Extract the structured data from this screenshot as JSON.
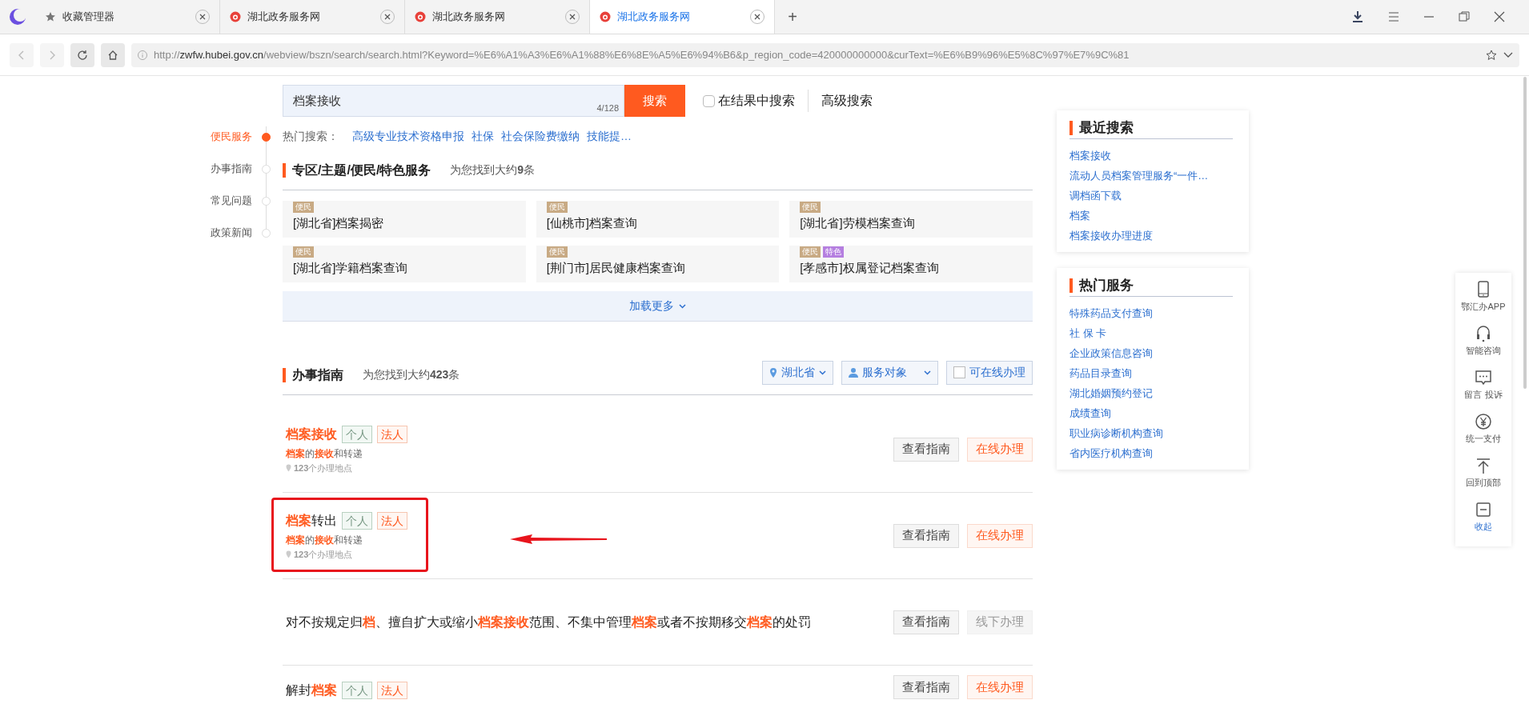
{
  "browser": {
    "tabs": [
      {
        "kind": "bookmarks",
        "label": "收藏管理器",
        "selected": false
      },
      {
        "kind": "site",
        "label": "湖北政务服务网",
        "selected": false
      },
      {
        "kind": "site",
        "label": "湖北政务服务网",
        "selected": false
      },
      {
        "kind": "site",
        "label": "湖北政务服务网",
        "selected": true
      }
    ],
    "new_tab": "+",
    "url_prefix": "http://",
    "url_host": "zwfw.hubei.gov.cn",
    "url_rest": "/webview/bszn/search/search.html?Keyword=%E6%A1%A3%E6%A1%88%E6%8E%A5%E6%94%B6&p_region_code=420000000000&curText=%E6%B9%96%E5%8C%97%E7%9C%81"
  },
  "side_nav": [
    {
      "label": "便民服务",
      "selected": true
    },
    {
      "label": "办事指南",
      "selected": false
    },
    {
      "label": "常见问题",
      "selected": false
    },
    {
      "label": "政策新闻",
      "selected": false
    }
  ],
  "search": {
    "value": "档案接收",
    "counter": "4/128",
    "button": "搜索",
    "within_results": {
      "label": "在结果中搜索",
      "checked": false
    },
    "advanced": "高级搜索"
  },
  "hot_search": {
    "label": "热门搜索：",
    "items": [
      "高级专业技术资格申报",
      "社保",
      "社会保险费缴纳",
      "技能提…"
    ]
  },
  "special_section": {
    "title": "专区/主题/便民/特色服务",
    "count": "为您找到大约**9**条",
    "cards": [
      {
        "tags": [
          {
            "label": "便民",
            "color": "#c8aa84"
          }
        ],
        "title": "[湖北省]档案揭密"
      },
      {
        "tags": [
          {
            "label": "便民",
            "color": "#c8aa84"
          }
        ],
        "title": "[仙桃市]档案查询"
      },
      {
        "tags": [
          {
            "label": "便民",
            "color": "#c8aa84"
          }
        ],
        "title": "[湖北省]劳模档案查询"
      },
      {
        "tags": [
          {
            "label": "便民",
            "color": "#c8aa84"
          }
        ],
        "title": "[湖北省]学籍档案查询"
      },
      {
        "tags": [
          {
            "label": "便民",
            "color": "#c8aa84"
          }
        ],
        "title": "[荆门市]居民健康档案查询"
      },
      {
        "tags": [
          {
            "label": "便民",
            "color": "#c8aa84"
          },
          {
            "label": "特色",
            "color": "#b57fe0"
          }
        ],
        "title": "[孝感市]权属登记档案查询"
      }
    ],
    "load_more": "加载更多"
  },
  "guide_section": {
    "title": "办事指南",
    "count": "为您找到大约**423**条",
    "filters": [
      {
        "kind": "region",
        "label": "湖北省"
      },
      {
        "kind": "audience",
        "label": "服务对象"
      },
      {
        "kind": "checkbox",
        "label": "可在线办理",
        "checked": false
      }
    ],
    "rows": [
      {
        "title": "**档案接收**",
        "tags": [
          {
            "kind": "personal",
            "label": "个人"
          },
          {
            "kind": "legal",
            "label": "法人"
          }
        ],
        "description": "**档案**的**接收**和转递",
        "locations": "**123**个办理地点",
        "highlighted": false,
        "buttons": [
          {
            "label": "查看指南",
            "kind": "guide"
          },
          {
            "label": "在线办理",
            "kind": "online",
            "disabled": false
          }
        ]
      },
      {
        "title": "**档案**转出",
        "tags": [
          {
            "kind": "personal",
            "label": "个人"
          },
          {
            "kind": "legal",
            "label": "法人"
          }
        ],
        "description": "**档案**的**接收**和转递",
        "locations": "**123**个办理地点",
        "highlighted": true,
        "buttons": [
          {
            "label": "查看指南",
            "kind": "guide"
          },
          {
            "label": "在线办理",
            "kind": "online",
            "disabled": false
          }
        ]
      },
      {
        "title": "对不按规定归**档**、擅自扩大或缩小**档案接收**范围、不集中管理**档案**或者不按期移交**档案**的处罚",
        "tags": [],
        "highlighted": false,
        "buttons": [
          {
            "label": "查看指南",
            "kind": "guide"
          },
          {
            "label": "线下办理",
            "kind": "online",
            "disabled": true
          }
        ]
      },
      {
        "title": "解封**档案**",
        "tags": [
          {
            "kind": "personal",
            "label": "个人"
          },
          {
            "kind": "legal",
            "label": "法人"
          }
        ],
        "highlighted": false,
        "buttons": [
          {
            "label": "查看指南",
            "kind": "guide"
          },
          {
            "label": "在线办理",
            "kind": "online",
            "disabled": false
          }
        ]
      }
    ]
  },
  "recent_searches": {
    "title": "最近搜索",
    "items": [
      "档案接收",
      "流动人员档案管理服务“一件…",
      "调档函下载",
      "档案",
      "档案接收办理进度"
    ]
  },
  "hot_services": {
    "title": "热门服务",
    "items": [
      "特殊药品支付查询",
      "社 保 卡",
      "企业政策信息咨询",
      "药品目录查询",
      "湖北婚姻预约登记",
      "成绩查询",
      "职业病诊断机构查询",
      "省内医疗机构查询"
    ]
  },
  "float_bar": [
    {
      "kind": "phone",
      "label": "鄂汇办APP"
    },
    {
      "kind": "headset",
      "label": "智能咨询"
    },
    {
      "kind": "message",
      "label": "留言 投诉"
    },
    {
      "kind": "yen",
      "label": "统一支付"
    },
    {
      "kind": "top",
      "label": "回到顶部"
    },
    {
      "kind": "collapse",
      "label": "收起"
    }
  ]
}
